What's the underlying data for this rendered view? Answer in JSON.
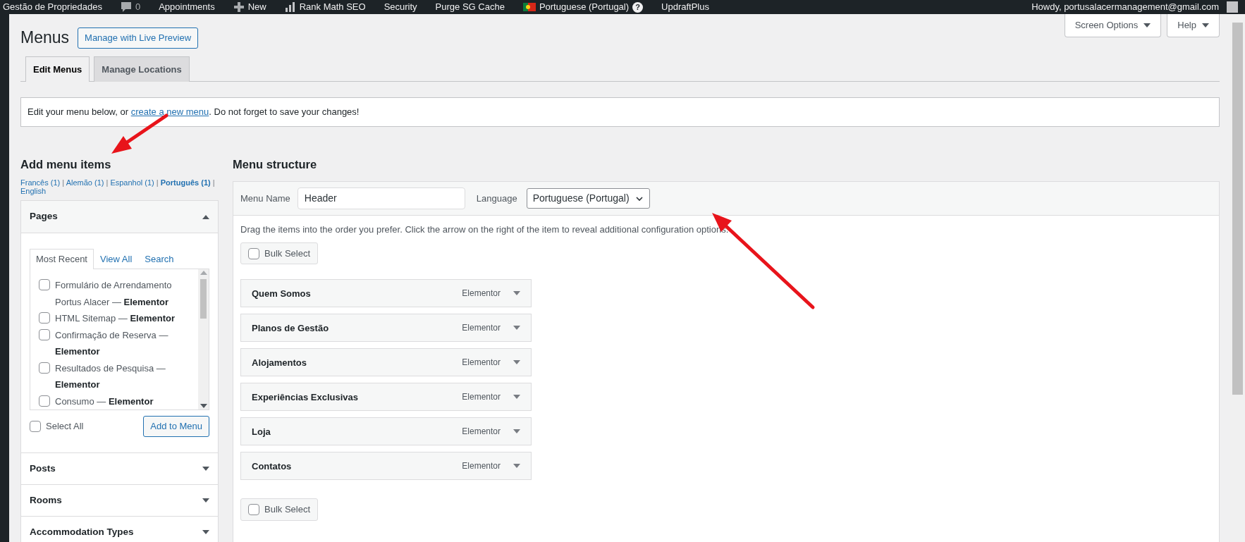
{
  "admin_bar": {
    "items": [
      {
        "kind": "site",
        "label": "Gestão de Propriedades"
      },
      {
        "kind": "comments",
        "label": "0"
      },
      {
        "kind": "text",
        "label": "Appointments"
      },
      {
        "kind": "new",
        "label": "New"
      },
      {
        "kind": "seo",
        "label": "Rank Math SEO"
      },
      {
        "kind": "text",
        "label": "Security"
      },
      {
        "kind": "text",
        "label": "Purge SG Cache"
      },
      {
        "kind": "language",
        "label": "Portuguese (Portugal)",
        "badge": "?"
      },
      {
        "kind": "text",
        "label": "UpdraftPlus"
      }
    ],
    "account": "Howdy, portusalacermanagement@gmail.com"
  },
  "page_title": "Menus",
  "live_preview_button": "Manage with Live Preview",
  "screen_meta": [
    "Screen Options",
    "Help"
  ],
  "tabs": [
    {
      "label": "Edit Menus",
      "selected": true
    },
    {
      "label": "Manage Locations",
      "selected": false
    }
  ],
  "notice": {
    "before": "Edit your menu below, or ",
    "link": "create a new menu",
    "after": ". Do not forget to save your changes!"
  },
  "add_items": {
    "title": "Add menu items",
    "language_filter": {
      "separator": "|",
      "items": [
        {
          "label": "Francês (1)",
          "selected": false
        },
        {
          "label": "Alemão (1)",
          "selected": false
        },
        {
          "label": "Espanhol (1)",
          "selected": false
        },
        {
          "label": "Português (1)",
          "selected": true
        },
        {
          "label": "English",
          "selected": false
        }
      ]
    },
    "sections": [
      {
        "title": "Pages",
        "expanded": true,
        "tabs": [
          {
            "label": "Most Recent",
            "selected": true
          },
          {
            "label": "View All",
            "selected": false
          },
          {
            "label": "Search",
            "selected": false
          }
        ],
        "items": [
          {
            "label": "Formulário de Arrendamento Portus Alacer — **Elementor**",
            "checked": false
          },
          {
            "label": "HTML Sitemap — **Elementor**",
            "checked": false
          },
          {
            "label": "Confirmação de Reserva — **Elementor**",
            "checked": false
          },
          {
            "label": "Resultados de Pesquisa — **Elementor**",
            "checked": false
          },
          {
            "label": "Consumo — **Elementor**",
            "checked": false
          }
        ],
        "select_all": {
          "label": "Select All",
          "checked": false
        },
        "button": "Add to Menu"
      },
      {
        "title": "Posts",
        "expanded": false
      },
      {
        "title": "Rooms",
        "expanded": false
      },
      {
        "title": "Accommodation Types",
        "expanded": false
      }
    ]
  },
  "menu_structure": {
    "title": "Menu structure",
    "menu_name": {
      "label": "Menu Name",
      "value": "Header"
    },
    "language": {
      "label": "Language",
      "value": "Portuguese (Portugal)"
    },
    "instructions": "Drag the items into the order you prefer. Click the arrow on the right of the item to reveal additional configuration options.",
    "bulk_select_top": {
      "label": "Bulk Select",
      "checked": false
    },
    "items": [
      {
        "title": "Quem Somos",
        "type": "Elementor"
      },
      {
        "title": "Planos de Gestão",
        "type": "Elementor"
      },
      {
        "title": "Alojamentos",
        "type": "Elementor"
      },
      {
        "title": "Experiências Exclusivas",
        "type": "Elementor"
      },
      {
        "title": "Loja",
        "type": "Elementor"
      },
      {
        "title": "Contatos",
        "type": "Elementor"
      }
    ],
    "bulk_select_bottom": {
      "label": "Bulk Select",
      "checked": false
    }
  }
}
